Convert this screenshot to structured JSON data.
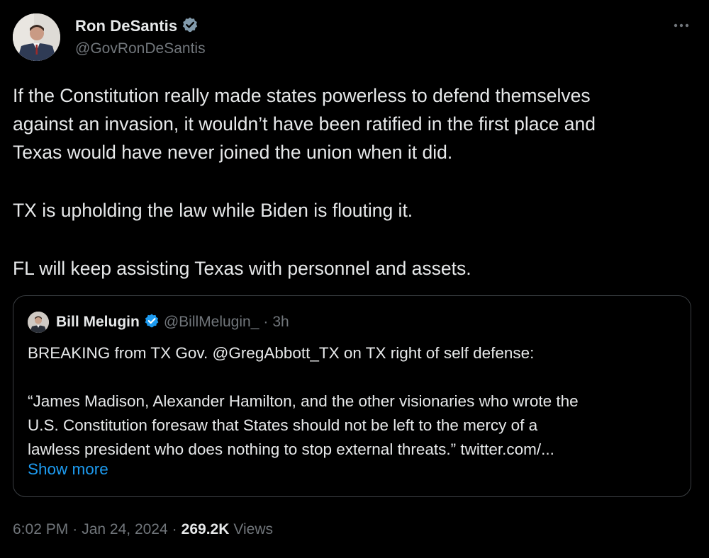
{
  "author": {
    "display_name": "Ron DeSantis",
    "handle": "@GovRonDeSantis",
    "verified_icon": "verified-badge-gray"
  },
  "menu": {
    "more_icon": "more-horizontal-icon"
  },
  "tweet": {
    "lines": [
      "If the Constitution really made states powerless to defend themselves",
      "against an invasion, it wouldn’t have been ratified in the first place and",
      "Texas would have never joined the union when it did.",
      "TX is upholding the law while Biden is flouting it.",
      "FL will keep assisting Texas with personnel and assets."
    ]
  },
  "quoted": {
    "display_name": "Bill Melugin",
    "handle": "@BillMelugin_",
    "separator": "·",
    "time": "3h",
    "verified_icon": "verified-badge-blue",
    "lines": [
      "BREAKING from TX Gov. @GregAbbott_TX on TX right of self defense:",
      "“James Madison, Alexander Hamilton, and the other visionaries who wrote the",
      "U.S. Constitution foresaw that States should not be left to the mercy of a",
      "lawless president who does nothing to stop external threats.” twitter.com/..."
    ],
    "show_more": "Show more"
  },
  "footer": {
    "time": "6:02 PM",
    "sep1": "·",
    "date": "Jan 24, 2024",
    "sep2": "·",
    "views_count": "269.2K",
    "views_label": "Views"
  },
  "colors": {
    "background": "#000000",
    "text": "#e7e9ea",
    "secondary": "#71767b",
    "link": "#1d9bf0",
    "border": "#3a3e42",
    "verified_gray": "#829aab",
    "verified_blue": "#1d9bf0"
  }
}
